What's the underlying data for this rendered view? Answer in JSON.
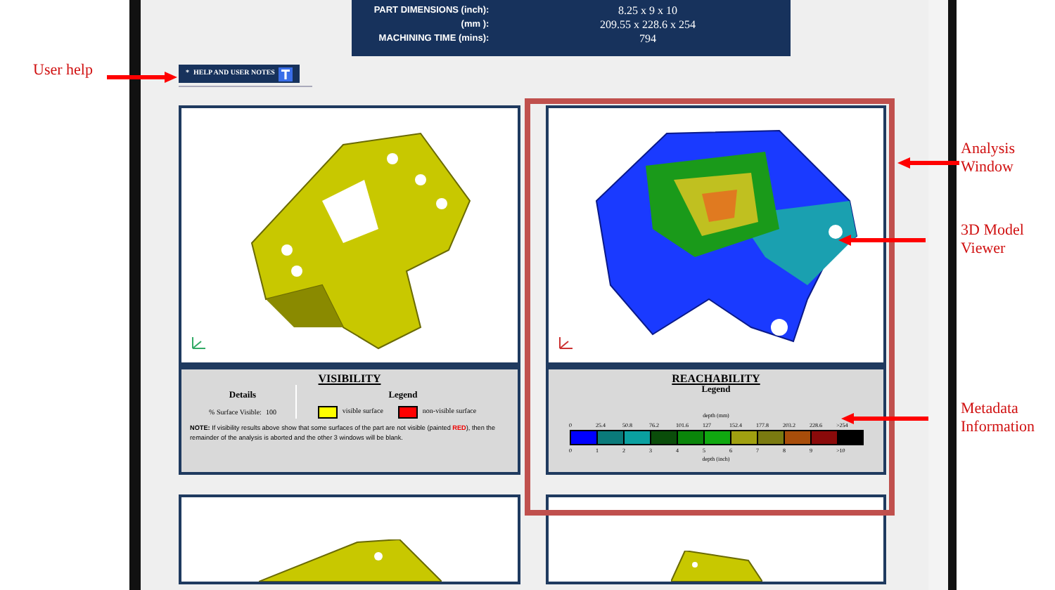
{
  "summary": {
    "rows": [
      {
        "label": "PART DIMENSIONS (inch)",
        "value": "8.25 x 9 x 10"
      },
      {
        "label": "(mm )",
        "value": "209.55 x 228.6 x 254"
      },
      {
        "label": "MACHINING TIME (mins)",
        "value": "794"
      }
    ],
    "separator": ":"
  },
  "help_button": {
    "bullet": "*",
    "label": "HELP AND USER NOTES"
  },
  "visibility": {
    "title": "VISIBILITY",
    "details_heading": "Details",
    "legend_heading": "Legend",
    "surface_label": "% Surface Visible:",
    "surface_value": "100",
    "legend": [
      {
        "label": "visible surface",
        "color": "#ffff00"
      },
      {
        "label": "non-visible surface",
        "color": "#ff0000"
      }
    ],
    "note": {
      "lead": "NOTE:",
      "text_before": "If visibility results above show that some surfaces of the part are not visible (painted",
      "highlight": "RED",
      "text_after": "), then the remainder of the analysis is aborted and the other 3 windows will be blank."
    }
  },
  "reachability": {
    "title": "REACHABILITY",
    "legend_heading": "Legend",
    "top_axis": "depth (mm)",
    "bottom_axis": "depth (inch)",
    "scale": [
      {
        "mm": "0",
        "inch": "0",
        "color": "#0000ff"
      },
      {
        "mm": "25.4",
        "inch": "1",
        "color": "#0a7a7a"
      },
      {
        "mm": "50.8",
        "inch": "2",
        "color": "#0aa0a0"
      },
      {
        "mm": "76.2",
        "inch": "3",
        "color": "#0a4d0a"
      },
      {
        "mm": "101.6",
        "inch": "4",
        "color": "#0a850a"
      },
      {
        "mm": "127",
        "inch": "5",
        "color": "#10a810"
      },
      {
        "mm": "152.4",
        "inch": "6",
        "color": "#a0a010"
      },
      {
        "mm": "177.8",
        "inch": "7",
        "color": "#7a7a10"
      },
      {
        "mm": "203.2",
        "inch": "8",
        "color": "#a84d0a"
      },
      {
        "mm": "228.6",
        "inch": "9",
        "color": "#8a0a0a"
      },
      {
        "mm": ">254",
        "inch": ">10",
        "color": "#000000"
      }
    ]
  },
  "callouts": [
    {
      "kind": "left",
      "text": "User help"
    },
    {
      "kind": "right",
      "text": "Analysis Window"
    },
    {
      "kind": "right",
      "text": "3D Model Viewer"
    },
    {
      "kind": "right",
      "text": "Metadata Information"
    }
  ]
}
